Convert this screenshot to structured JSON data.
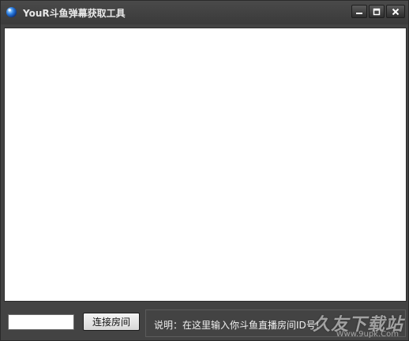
{
  "window": {
    "title": "YouR斗鱼弹幕获取工具",
    "icon": "blue-sphere-icon"
  },
  "controls": {
    "minimize_icon": "minimize-icon",
    "maximize_icon": "maximize-icon",
    "close_icon": "close-icon"
  },
  "room": {
    "input_value": "",
    "input_placeholder": "",
    "connect_label": "连接房间"
  },
  "note": {
    "text": "说明：在这里输入你斗鱼直播房间ID号!"
  },
  "watermark": {
    "text": "久友下载站",
    "url": "Www.9upk.Com"
  },
  "colors": {
    "frame": "#434343",
    "titlebar": "#3a3a3a",
    "content": "#ffffff",
    "title_text": "#e8e8e8"
  }
}
